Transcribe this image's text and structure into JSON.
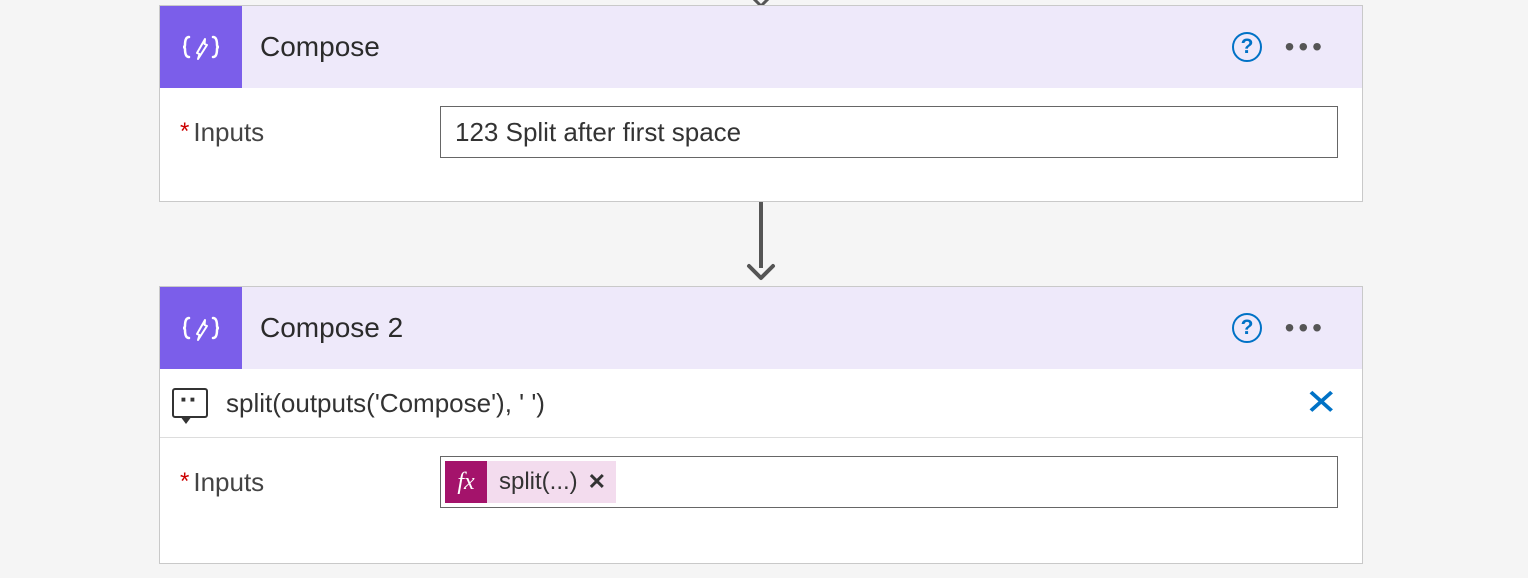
{
  "compose1": {
    "title": "Compose",
    "inputs_label": "Inputs",
    "inputs_value": "123 Split after first space"
  },
  "compose2": {
    "title": "Compose 2",
    "inputs_label": "Inputs",
    "peek_expression": "split(outputs('Compose'), ' ')",
    "pill_label": "split(...)",
    "fx_label": "fx"
  },
  "ui": {
    "help": "?",
    "more": "•••"
  }
}
